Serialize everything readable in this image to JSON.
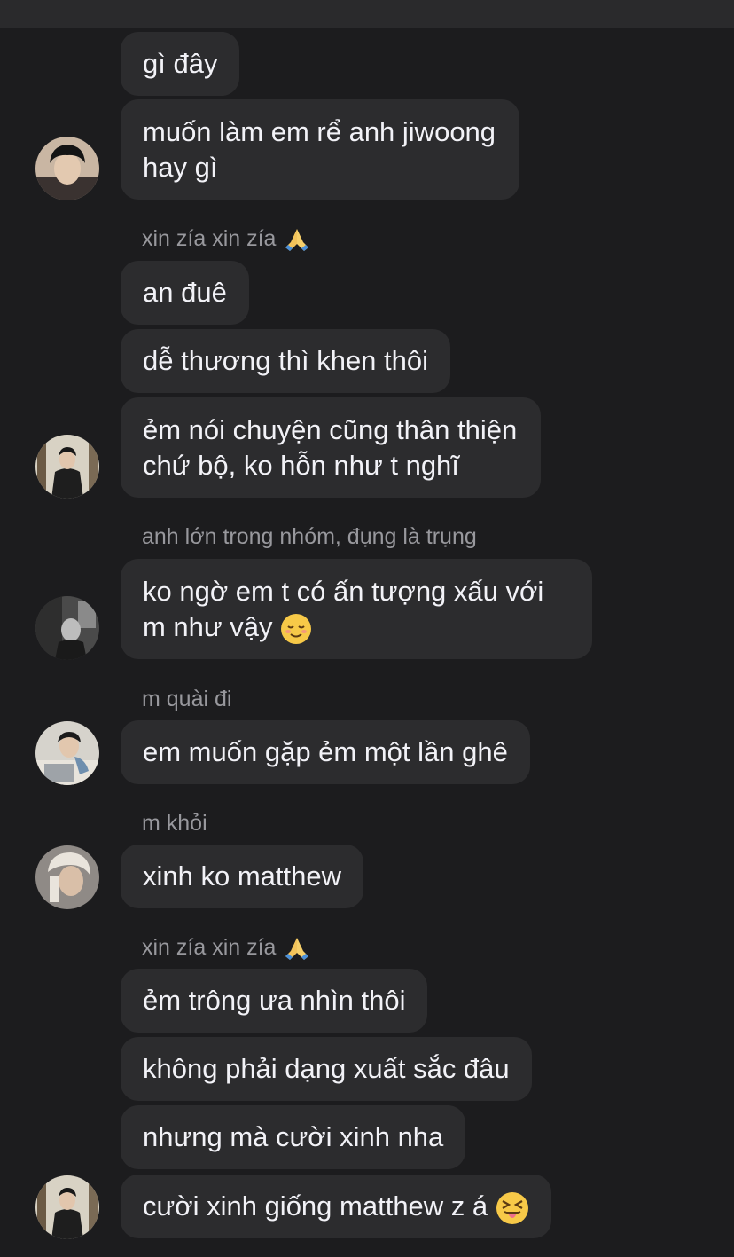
{
  "messages": [
    {
      "text": "gì đây"
    },
    {
      "line1": "muốn làm em rể anh jiwoong",
      "line2": "hay gì"
    },
    {
      "sender": "xin zía xin zía",
      "sender_emoji": "folded-hands-emoji"
    },
    {
      "text": "an đuê"
    },
    {
      "text": "dễ thương thì khen thôi"
    },
    {
      "line1": "ẻm nói chuyện cũng thân thiện",
      "line2": "chứ bộ, ko hỗn như t nghĩ"
    },
    {
      "sender": "anh lớn trong nhóm, đụng là trụng"
    },
    {
      "line1": "ko ngờ em t có ấn tượng xấu với",
      "line2": "m như vậy",
      "emoji": "relieved-face-emoji"
    },
    {
      "sender": "m quài đi"
    },
    {
      "text": "em muốn gặp ẻm một lần ghê"
    },
    {
      "sender": "m khỏi"
    },
    {
      "text": "xinh ko matthew"
    },
    {
      "sender": "xin zía xin zía",
      "sender_emoji": "folded-hands-emoji"
    },
    {
      "text": "ẻm trông ưa nhìn thôi"
    },
    {
      "text": "không phải dạng xuất sắc đâu"
    },
    {
      "text": "nhưng mà cười xinh nha"
    },
    {
      "text": "cười xinh giống matthew z á",
      "emoji": "squinting-tongue-face-emoji"
    }
  ],
  "avatars": [
    "avatar-1",
    "avatar-2",
    "avatar-3",
    "avatar-4",
    "avatar-5",
    "avatar-6"
  ],
  "colors": {
    "background": "#1c1c1e",
    "bubble": "#2c2c2e",
    "text": "#f2f2f7",
    "sender": "#98989d"
  }
}
